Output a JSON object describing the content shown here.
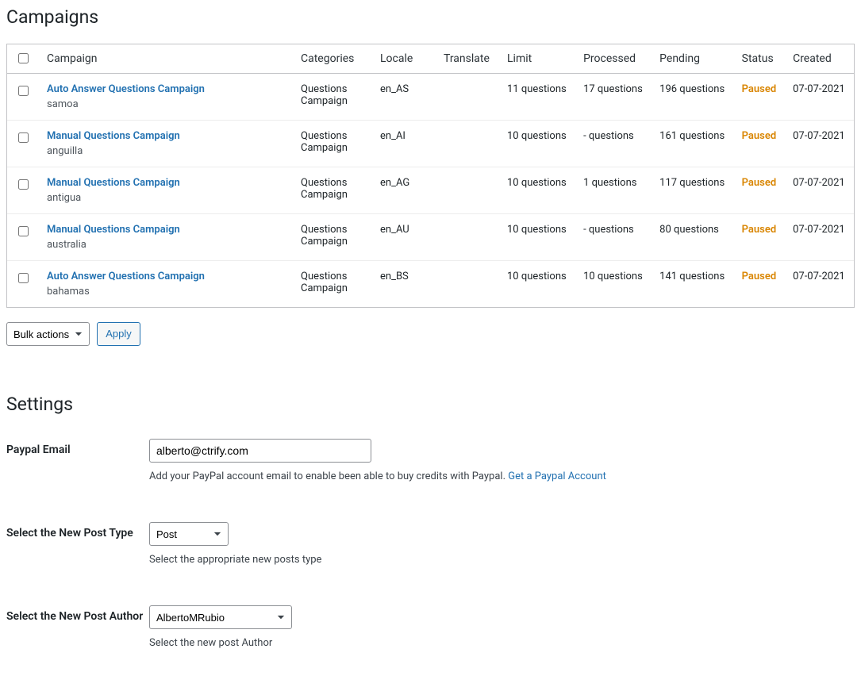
{
  "page_title": "Campaigns",
  "headers": {
    "campaign": "Campaign",
    "categories": "Categories",
    "locale": "Locale",
    "translate": "Translate",
    "limit": "Limit",
    "processed": "Processed",
    "pending": "Pending",
    "status": "Status",
    "created": "Created"
  },
  "rows": [
    {
      "name": "Auto Answer Questions Campaign",
      "sub": "samoa",
      "categories": "Questions Campaign",
      "locale": "en_AS",
      "translate": "",
      "limit": "11 questions",
      "processed": "17 questions",
      "pending": "196 questions",
      "status": "Paused",
      "created": "07-07-2021"
    },
    {
      "name": "Manual Questions Campaign",
      "sub": "anguilla",
      "categories": "Questions Campaign",
      "locale": "en_AI",
      "translate": "",
      "limit": "10 questions",
      "processed": "- questions",
      "pending": "161 questions",
      "status": "Paused",
      "created": "07-07-2021"
    },
    {
      "name": "Manual Questions Campaign",
      "sub": "antigua",
      "categories": "Questions Campaign",
      "locale": "en_AG",
      "translate": "",
      "limit": "10 questions",
      "processed": "1 questions",
      "pending": "117 questions",
      "status": "Paused",
      "created": "07-07-2021"
    },
    {
      "name": "Manual Questions Campaign",
      "sub": "australia",
      "categories": "Questions Campaign",
      "locale": "en_AU",
      "translate": "",
      "limit": "10 questions",
      "processed": "- questions",
      "pending": "80 questions",
      "status": "Paused",
      "created": "07-07-2021"
    },
    {
      "name": "Auto Answer Questions Campaign",
      "sub": "bahamas",
      "categories": "Questions Campaign",
      "locale": "en_BS",
      "translate": "",
      "limit": "10 questions",
      "processed": "10 questions",
      "pending": "141 questions",
      "status": "Paused",
      "created": "07-07-2021"
    }
  ],
  "bulk": {
    "selected": "Bulk actions",
    "apply": "Apply"
  },
  "settings": {
    "title": "Settings",
    "paypal_email": {
      "label": "Paypal Email",
      "value": "alberto@ctrify.com",
      "help_prefix": "Add your PayPal account email to enable been able to buy credits with Paypal. ",
      "help_link": "Get a Paypal Account"
    },
    "post_type": {
      "label": "Select the New Post Type",
      "selected": "Post",
      "help": "Select the appropriate new posts type"
    },
    "post_author": {
      "label": "Select the New Post Author",
      "selected": "AlbertoMRubio",
      "help": "Select the new post Author"
    }
  }
}
